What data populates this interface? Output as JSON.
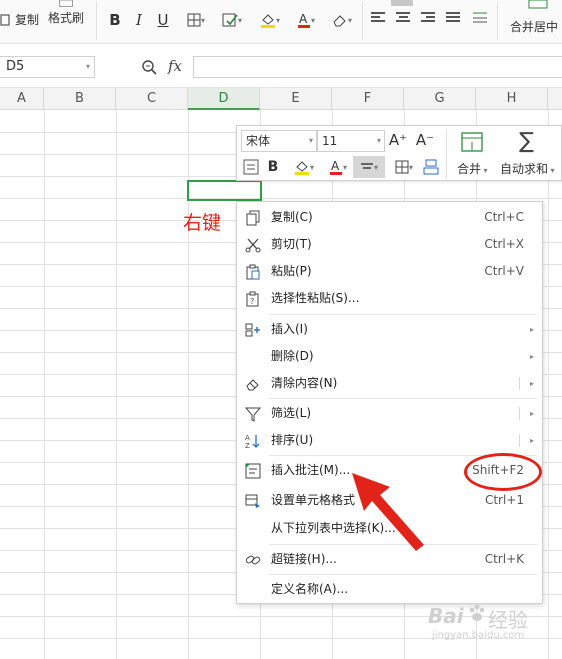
{
  "ribbon": {
    "copy_label": "复制",
    "format_painter_label": "格式刷",
    "bold": "B",
    "italic": "I",
    "underline": "U",
    "merge_center_label": "合并居中",
    "icons": [
      "paste-icon",
      "format-painter-icon",
      "bold-icon",
      "italic-icon",
      "underline-icon",
      "border-icon",
      "fill-color-icon",
      "font-color-icon",
      "clear-icon",
      "align-icons",
      "merge-icon"
    ],
    "accent_colors": {
      "fill": "#f5d800",
      "font": "#e2231a"
    }
  },
  "formula_bar": {
    "name_box": "D5",
    "fx": "fx",
    "formula_value": ""
  },
  "grid": {
    "columns": [
      "A",
      "B",
      "C",
      "D",
      "E",
      "F",
      "G",
      "H"
    ],
    "active_column": "D",
    "selected_cell": "D5"
  },
  "annotation": {
    "right_click_note": "右键",
    "highlight_color": "#e2231a"
  },
  "mini_toolbar": {
    "font_name": "宋体",
    "font_size": "11",
    "increase_font": "A⁺",
    "decrease_font": "A⁻",
    "bold": "B",
    "merge_label": "合并",
    "autosum_label": "自动求和",
    "font_color": "#e2231a",
    "fill_color": "#f5d800"
  },
  "context_menu": {
    "items": [
      {
        "label": "复制(C)",
        "shortcut": "Ctrl+C",
        "icon": "copy-icon"
      },
      {
        "label": "剪切(T)",
        "shortcut": "Ctrl+X",
        "icon": "cut-icon"
      },
      {
        "label": "粘贴(P)",
        "shortcut": "Ctrl+V",
        "icon": "paste-icon"
      },
      {
        "label": "选择性粘贴(S)...",
        "shortcut": "",
        "icon": "paste-special-icon"
      },
      {
        "label": "插入(I)",
        "shortcut": "",
        "icon": "insert-icon",
        "submenu": true
      },
      {
        "label": "删除(D)",
        "shortcut": "",
        "icon": "",
        "submenu": true
      },
      {
        "label": "清除内容(N)",
        "shortcut": "",
        "icon": "eraser-icon",
        "submenu": true
      },
      {
        "label": "筛选(L)",
        "shortcut": "",
        "icon": "filter-icon",
        "submenu": true
      },
      {
        "label": "排序(U)",
        "shortcut": "",
        "icon": "sort-icon",
        "submenu": true
      },
      {
        "label": "插入批注(M)...",
        "shortcut": "Shift+F2",
        "icon": "insert-comment-icon"
      },
      {
        "label": "设置单元格格式",
        "shortcut": "Ctrl+1",
        "icon": "format-cells-icon"
      },
      {
        "label": "从下拉列表中选择(K)...",
        "shortcut": "",
        "icon": ""
      },
      {
        "label": "超链接(H)...",
        "shortcut": "Ctrl+K",
        "icon": "hyperlink-icon"
      },
      {
        "label": "定义名称(A)...",
        "shortcut": "",
        "icon": ""
      }
    ]
  },
  "watermark": {
    "brand": "Bai",
    "brand_cn": "经验",
    "url": "jingyan.baidu.com"
  }
}
